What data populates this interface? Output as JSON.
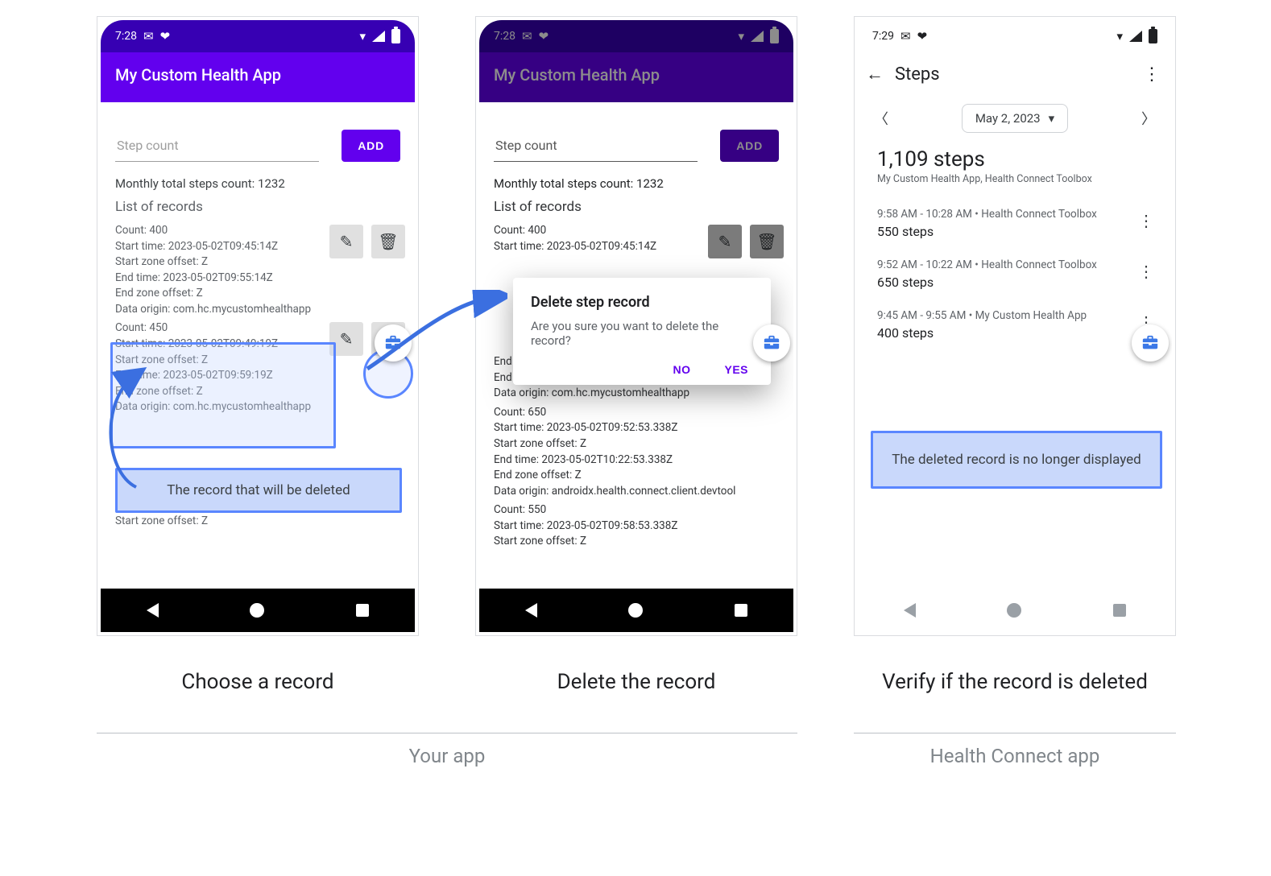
{
  "colors": {
    "primary": "#6200ee",
    "primary_dark": "#3700b3",
    "highlight": "#5a86ff"
  },
  "status": {
    "time_app": "7:28",
    "time_hc": "7:29"
  },
  "app": {
    "title": "My Custom Health App",
    "input_placeholder": "Step count",
    "add_label": "ADD",
    "monthly_label": "Monthly total steps count: 1232",
    "list_header": "List of records",
    "records": [
      {
        "count": "Count: 400",
        "start": "Start time: 2023-05-02T09:45:14Z",
        "szo": "Start zone offset: Z",
        "end": "End time: 2023-05-02T09:55:14Z",
        "ezo": "End zone offset: Z",
        "origin": "Data origin: com.hc.mycustomhealthapp"
      },
      {
        "count": "Count: 450",
        "start": "Start time: 2023-05-02T09:49:19Z",
        "szo": "Start zone offset: Z",
        "end": "End time: 2023-05-02T09:59:19Z",
        "ezo": "End zone offset: Z",
        "origin": "Data origin: com.hc.mycustomhealthapp"
      },
      {
        "count": "Count: 650",
        "start": "Start time: 2023-05-02T09:52:53.338Z",
        "szo": "Start zone offset: Z",
        "end": "End time: 2023-05-02T10:22:53.338Z",
        "ezo": "End zone offset: Z",
        "origin": "Data origin: androidx.health.connect.client.devtool"
      },
      {
        "count": "Count: 550",
        "start": "Start time: 2023-05-02T09:58:53.338Z",
        "szo": "Start zone offset: Z",
        "end": "",
        "ezo": "",
        "origin": ""
      }
    ]
  },
  "dialog": {
    "title": "Delete step record",
    "body": "Are you sure you want to delete the record?",
    "no": "NO",
    "yes": "YES"
  },
  "hc": {
    "title": "Steps",
    "date": "May 2, 2023",
    "total": "1,109 steps",
    "sources": "My Custom Health App, Health Connect Toolbox",
    "items": [
      {
        "meta": "9:58 AM - 10:28 AM • Health Connect Toolbox",
        "val": "550 steps"
      },
      {
        "meta": "9:52 AM - 10:22 AM • Health Connect Toolbox",
        "val": "650 steps"
      },
      {
        "meta": "9:45 AM - 9:55 AM • My Custom Health App",
        "val": "400 steps"
      }
    ]
  },
  "annotations": {
    "phone1_note": "The record that will be deleted",
    "phone3_note": "The deleted record is no longer displayed"
  },
  "captions": {
    "c1": "Choose a record",
    "c2": "Delete the record",
    "c3": "Verify if the record is deleted"
  },
  "groups": {
    "left": "Your app",
    "right": "Health Connect app"
  }
}
